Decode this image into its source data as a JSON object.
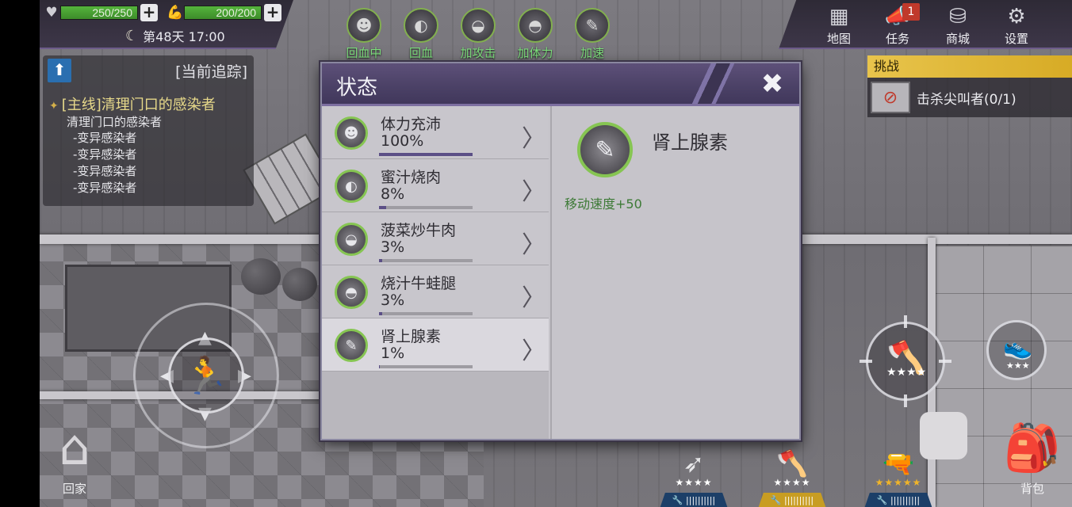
{
  "hud": {
    "health": {
      "icon": "heart-icon",
      "value": "250/250"
    },
    "stamina": {
      "icon": "muscle-arm-icon",
      "value": "200/200"
    },
    "day": {
      "icon": "moon-icon",
      "text": "第48天 17:00"
    }
  },
  "buffs": [
    {
      "label": "回血中",
      "icon": "stamina-body-icon"
    },
    {
      "label": "回血",
      "icon": "honey-meat-icon"
    },
    {
      "label": "加攻击",
      "icon": "beef-dish-icon"
    },
    {
      "label": "加体力",
      "icon": "frog-leg-icon"
    },
    {
      "label": "加速",
      "icon": "syringe-icon"
    }
  ],
  "menu": [
    {
      "label": "地图",
      "icon": "map-icon"
    },
    {
      "label": "任务",
      "icon": "megaphone-icon",
      "badge": "1"
    },
    {
      "label": "商城",
      "icon": "coins-icon"
    },
    {
      "label": "设置",
      "icon": "gear-icon"
    }
  ],
  "tracking": {
    "title": "[当前追踪]",
    "quest_title": "[主线]清理门口的感染者",
    "quest_sub": "清理门口的感染者",
    "items": [
      "-变异感染者",
      "-变异感染者",
      "-变异感染者",
      "-变异感染者"
    ]
  },
  "challenge": {
    "header": "挑战",
    "text": "击杀尖叫者(0/1)"
  },
  "dialog": {
    "title": "状态",
    "close_icon": "close-icon",
    "statuses": [
      {
        "name": "体力充沛",
        "percent": "100%",
        "fill": 1.0,
        "icon": "stamina-body-icon"
      },
      {
        "name": "蜜汁烧肉",
        "percent": "8%",
        "fill": 0.08,
        "icon": "honey-meat-icon"
      },
      {
        "name": "菠菜炒牛肉",
        "percent": "3%",
        "fill": 0.03,
        "icon": "beef-dish-icon"
      },
      {
        "name": "烧汁牛蛙腿",
        "percent": "3%",
        "fill": 0.03,
        "icon": "frog-leg-icon"
      },
      {
        "name": "肾上腺素",
        "percent": "1%",
        "fill": 0.01,
        "icon": "syringe-icon",
        "selected": true
      }
    ],
    "detail": {
      "name": "肾上腺素",
      "effect": "移动速度+50",
      "icon": "syringe-icon"
    }
  },
  "bottom": {
    "home_label": "回家",
    "bag_label": "背包",
    "weapons": [
      {
        "icon": "bow-icon",
        "stars": "★★★★",
        "star_color": "#ffffff",
        "bar": "gray"
      },
      {
        "icon": "axe-icon",
        "stars": "★★★★",
        "star_color": "#ffffff",
        "bar": "gold"
      },
      {
        "icon": "revolver-icon",
        "stars": "★★★★★",
        "star_color": "#f0b429",
        "bar": "blue"
      }
    ],
    "attack_stars": "★★★★",
    "shoe_stars": "★★★"
  },
  "colors": {
    "accent_green": "#86c552",
    "header_purple": "#4b4166",
    "challenge_gold": "#e8c44c",
    "progress": "#5b4f86"
  }
}
